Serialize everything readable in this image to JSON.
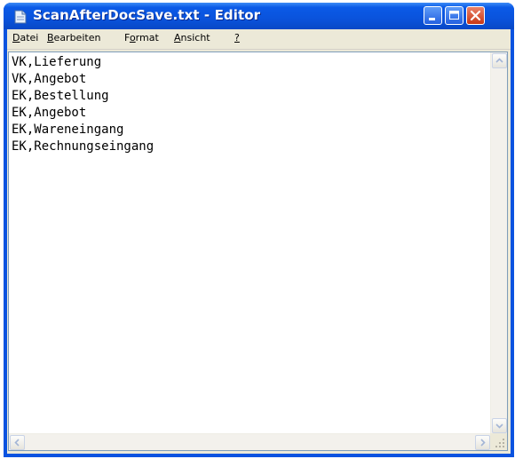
{
  "window": {
    "title": "ScanAfterDocSave.txt - Editor"
  },
  "menu": [
    {
      "pre": "",
      "u": "D",
      "post": "atei"
    },
    {
      "pre": "",
      "u": "B",
      "post": "earbeiten"
    },
    {
      "pre": "F",
      "u": "o",
      "post": "rmat"
    },
    {
      "pre": "",
      "u": "A",
      "post": "nsicht"
    },
    {
      "pre": "",
      "u": "?",
      "post": ""
    }
  ],
  "editor": {
    "lines": [
      "VK,Lieferung",
      "VK,Angebot",
      "EK,Bestellung",
      "EK,Angebot",
      "EK,Wareneingang",
      "EK,Rechnungseingang"
    ]
  },
  "icons": {
    "app": "notepad-icon",
    "minimize": "minimize-icon",
    "maximize": "maximize-icon",
    "close": "close-icon",
    "scroll_up": "arrow-up-icon",
    "scroll_down": "arrow-down-icon",
    "scroll_left": "arrow-left-icon",
    "scroll_right": "arrow-right-icon",
    "grip": "resize-grip-icon"
  }
}
